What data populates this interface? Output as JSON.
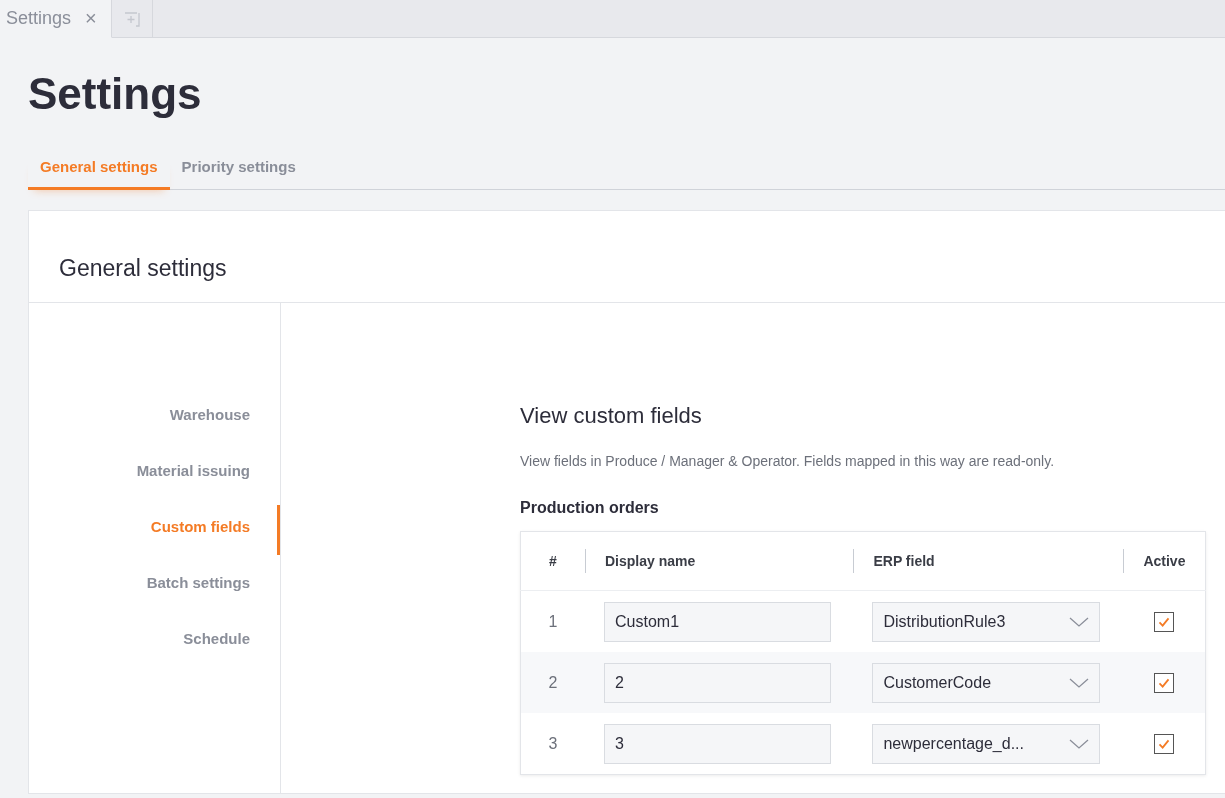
{
  "doc_tabs": [
    {
      "label": "Settings",
      "close": "×",
      "selected": true
    }
  ],
  "title": "Settings",
  "tabs": [
    {
      "label": "General settings",
      "selected": true
    },
    {
      "label": "Priority settings",
      "selected": false
    }
  ],
  "card": {
    "title": "General settings",
    "sidebar": {
      "items": [
        {
          "label": "Warehouse",
          "selected": false
        },
        {
          "label": "Material issuing",
          "selected": false
        },
        {
          "label": "Custom fields",
          "selected": true
        },
        {
          "label": "Batch settings",
          "selected": false
        },
        {
          "label": "Schedule",
          "selected": false
        }
      ]
    },
    "section": {
      "title": "View custom fields",
      "description": "View fields in Produce / Manager & Operator. Fields mapped in this way are read-only.",
      "subtitle": "Production orders",
      "table": {
        "columns": [
          "#",
          "Display name",
          "ERP field",
          "Active"
        ],
        "rows": [
          {
            "number": "1",
            "display_name": "Custom1",
            "erp_field": "DistributionRule3",
            "active": true
          },
          {
            "number": "2",
            "display_name": "2",
            "erp_field": "CustomerCode",
            "active": true
          },
          {
            "number": "3",
            "display_name": "3",
            "erp_field": "newpercentage_d...",
            "active": true
          }
        ]
      }
    }
  }
}
